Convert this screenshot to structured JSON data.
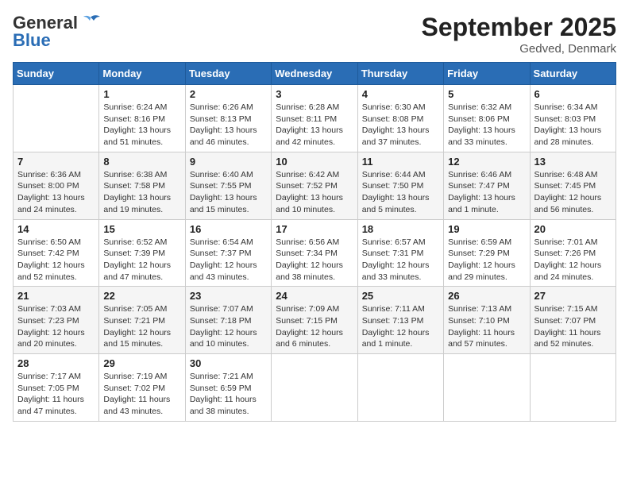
{
  "header": {
    "logo_general": "General",
    "logo_blue": "Blue",
    "title": "September 2025",
    "location": "Gedved, Denmark"
  },
  "days_of_week": [
    "Sunday",
    "Monday",
    "Tuesday",
    "Wednesday",
    "Thursday",
    "Friday",
    "Saturday"
  ],
  "weeks": [
    [
      {
        "day": "",
        "sunrise": "",
        "sunset": "",
        "daylight": ""
      },
      {
        "day": "1",
        "sunrise": "Sunrise: 6:24 AM",
        "sunset": "Sunset: 8:16 PM",
        "daylight": "Daylight: 13 hours and 51 minutes."
      },
      {
        "day": "2",
        "sunrise": "Sunrise: 6:26 AM",
        "sunset": "Sunset: 8:13 PM",
        "daylight": "Daylight: 13 hours and 46 minutes."
      },
      {
        "day": "3",
        "sunrise": "Sunrise: 6:28 AM",
        "sunset": "Sunset: 8:11 PM",
        "daylight": "Daylight: 13 hours and 42 minutes."
      },
      {
        "day": "4",
        "sunrise": "Sunrise: 6:30 AM",
        "sunset": "Sunset: 8:08 PM",
        "daylight": "Daylight: 13 hours and 37 minutes."
      },
      {
        "day": "5",
        "sunrise": "Sunrise: 6:32 AM",
        "sunset": "Sunset: 8:06 PM",
        "daylight": "Daylight: 13 hours and 33 minutes."
      },
      {
        "day": "6",
        "sunrise": "Sunrise: 6:34 AM",
        "sunset": "Sunset: 8:03 PM",
        "daylight": "Daylight: 13 hours and 28 minutes."
      }
    ],
    [
      {
        "day": "7",
        "sunrise": "Sunrise: 6:36 AM",
        "sunset": "Sunset: 8:00 PM",
        "daylight": "Daylight: 13 hours and 24 minutes."
      },
      {
        "day": "8",
        "sunrise": "Sunrise: 6:38 AM",
        "sunset": "Sunset: 7:58 PM",
        "daylight": "Daylight: 13 hours and 19 minutes."
      },
      {
        "day": "9",
        "sunrise": "Sunrise: 6:40 AM",
        "sunset": "Sunset: 7:55 PM",
        "daylight": "Daylight: 13 hours and 15 minutes."
      },
      {
        "day": "10",
        "sunrise": "Sunrise: 6:42 AM",
        "sunset": "Sunset: 7:52 PM",
        "daylight": "Daylight: 13 hours and 10 minutes."
      },
      {
        "day": "11",
        "sunrise": "Sunrise: 6:44 AM",
        "sunset": "Sunset: 7:50 PM",
        "daylight": "Daylight: 13 hours and 5 minutes."
      },
      {
        "day": "12",
        "sunrise": "Sunrise: 6:46 AM",
        "sunset": "Sunset: 7:47 PM",
        "daylight": "Daylight: 13 hours and 1 minute."
      },
      {
        "day": "13",
        "sunrise": "Sunrise: 6:48 AM",
        "sunset": "Sunset: 7:45 PM",
        "daylight": "Daylight: 12 hours and 56 minutes."
      }
    ],
    [
      {
        "day": "14",
        "sunrise": "Sunrise: 6:50 AM",
        "sunset": "Sunset: 7:42 PM",
        "daylight": "Daylight: 12 hours and 52 minutes."
      },
      {
        "day": "15",
        "sunrise": "Sunrise: 6:52 AM",
        "sunset": "Sunset: 7:39 PM",
        "daylight": "Daylight: 12 hours and 47 minutes."
      },
      {
        "day": "16",
        "sunrise": "Sunrise: 6:54 AM",
        "sunset": "Sunset: 7:37 PM",
        "daylight": "Daylight: 12 hours and 43 minutes."
      },
      {
        "day": "17",
        "sunrise": "Sunrise: 6:56 AM",
        "sunset": "Sunset: 7:34 PM",
        "daylight": "Daylight: 12 hours and 38 minutes."
      },
      {
        "day": "18",
        "sunrise": "Sunrise: 6:57 AM",
        "sunset": "Sunset: 7:31 PM",
        "daylight": "Daylight: 12 hours and 33 minutes."
      },
      {
        "day": "19",
        "sunrise": "Sunrise: 6:59 AM",
        "sunset": "Sunset: 7:29 PM",
        "daylight": "Daylight: 12 hours and 29 minutes."
      },
      {
        "day": "20",
        "sunrise": "Sunrise: 7:01 AM",
        "sunset": "Sunset: 7:26 PM",
        "daylight": "Daylight: 12 hours and 24 minutes."
      }
    ],
    [
      {
        "day": "21",
        "sunrise": "Sunrise: 7:03 AM",
        "sunset": "Sunset: 7:23 PM",
        "daylight": "Daylight: 12 hours and 20 minutes."
      },
      {
        "day": "22",
        "sunrise": "Sunrise: 7:05 AM",
        "sunset": "Sunset: 7:21 PM",
        "daylight": "Daylight: 12 hours and 15 minutes."
      },
      {
        "day": "23",
        "sunrise": "Sunrise: 7:07 AM",
        "sunset": "Sunset: 7:18 PM",
        "daylight": "Daylight: 12 hours and 10 minutes."
      },
      {
        "day": "24",
        "sunrise": "Sunrise: 7:09 AM",
        "sunset": "Sunset: 7:15 PM",
        "daylight": "Daylight: 12 hours and 6 minutes."
      },
      {
        "day": "25",
        "sunrise": "Sunrise: 7:11 AM",
        "sunset": "Sunset: 7:13 PM",
        "daylight": "Daylight: 12 hours and 1 minute."
      },
      {
        "day": "26",
        "sunrise": "Sunrise: 7:13 AM",
        "sunset": "Sunset: 7:10 PM",
        "daylight": "Daylight: 11 hours and 57 minutes."
      },
      {
        "day": "27",
        "sunrise": "Sunrise: 7:15 AM",
        "sunset": "Sunset: 7:07 PM",
        "daylight": "Daylight: 11 hours and 52 minutes."
      }
    ],
    [
      {
        "day": "28",
        "sunrise": "Sunrise: 7:17 AM",
        "sunset": "Sunset: 7:05 PM",
        "daylight": "Daylight: 11 hours and 47 minutes."
      },
      {
        "day": "29",
        "sunrise": "Sunrise: 7:19 AM",
        "sunset": "Sunset: 7:02 PM",
        "daylight": "Daylight: 11 hours and 43 minutes."
      },
      {
        "day": "30",
        "sunrise": "Sunrise: 7:21 AM",
        "sunset": "Sunset: 6:59 PM",
        "daylight": "Daylight: 11 hours and 38 minutes."
      },
      {
        "day": "",
        "sunrise": "",
        "sunset": "",
        "daylight": ""
      },
      {
        "day": "",
        "sunrise": "",
        "sunset": "",
        "daylight": ""
      },
      {
        "day": "",
        "sunrise": "",
        "sunset": "",
        "daylight": ""
      },
      {
        "day": "",
        "sunrise": "",
        "sunset": "",
        "daylight": ""
      }
    ]
  ]
}
